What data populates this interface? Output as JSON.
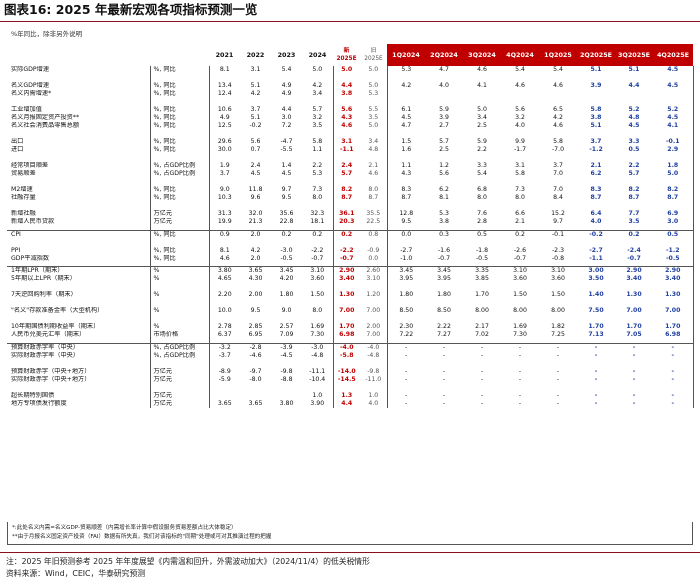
{
  "title": "图表16:  2025 年最新宏观各项指标预测一览",
  "unit_note": "%年同比，除非另外说明",
  "columns": {
    "years": [
      "2021",
      "2022",
      "2023",
      "2024"
    ],
    "est_line1": "新",
    "est_line2": "2025E",
    "prev_line1": "旧",
    "prev_line2": "2025E",
    "quarters": [
      "1Q2024",
      "2Q2024",
      "3Q2024",
      "4Q2024",
      "1Q2025",
      "2Q2025E",
      "3Q2025E",
      "4Q2025E"
    ]
  },
  "rows": [
    {
      "name": "实际GDP增速",
      "unit": "%, 同比",
      "y": [
        "8.1",
        "3.1",
        "5.4",
        "5.0"
      ],
      "e": "5.0",
      "p": "5.0",
      "q": [
        "5.3",
        "4.7",
        "4.6",
        "5.4",
        "5.4",
        "5.1",
        "5.1",
        "4.5"
      ]
    },
    {
      "gap": true
    },
    {
      "name": "名义GDP增速",
      "unit": "%, 同比",
      "y": [
        "13.4",
        "5.1",
        "4.9",
        "4.2"
      ],
      "e": "4.4",
      "p": "5.0",
      "q": [
        "4.2",
        "4.0",
        "4.1",
        "4.6",
        "4.6",
        "3.9",
        "4.4",
        "4.5"
      ]
    },
    {
      "name": "名义内需增速*",
      "unit": "%, 同比",
      "y": [
        "12.4",
        "4.2",
        "4.9",
        "3.4"
      ],
      "e": "3.8",
      "p": "5.3",
      "q": [
        "",
        "",
        "",
        "",
        "",
        "",
        "",
        ""
      ]
    },
    {
      "gap": true
    },
    {
      "name": "工业增加值",
      "unit": "%, 同比",
      "y": [
        "10.6",
        "3.7",
        "4.4",
        "5.7"
      ],
      "e": "5.6",
      "p": "5.5",
      "q": [
        "6.1",
        "5.9",
        "5.0",
        "5.6",
        "6.5",
        "5.8",
        "5.2",
        "5.2"
      ]
    },
    {
      "name": "名义月报固定资产投资**",
      "unit": "%, 同比",
      "y": [
        "4.9",
        "5.1",
        "3.0",
        "3.2"
      ],
      "e": "4.3",
      "p": "3.5",
      "q": [
        "4.5",
        "3.9",
        "3.4",
        "3.2",
        "4.2",
        "3.8",
        "4.8",
        "4.5"
      ]
    },
    {
      "name": "名义社会消费品零售总额",
      "unit": "%, 同比",
      "y": [
        "12.5",
        "-0.2",
        "7.2",
        "3.5"
      ],
      "e": "4.6",
      "p": "5.0",
      "q": [
        "4.7",
        "2.7",
        "2.5",
        "4.0",
        "4.6",
        "5.1",
        "4.5",
        "4.1"
      ]
    },
    {
      "gap": true
    },
    {
      "name": "出口",
      "unit": "%, 同比",
      "y": [
        "29.6",
        "5.6",
        "-4.7",
        "5.8"
      ],
      "e": "3.1",
      "p": "3.4",
      "q": [
        "1.5",
        "5.7",
        "5.9",
        "9.9",
        "5.8",
        "3.7",
        "3.3",
        "-0.1"
      ]
    },
    {
      "name": "进口",
      "unit": "%, 同比",
      "y": [
        "30.0",
        "0.7",
        "-5.5",
        "1.1"
      ],
      "e": "-1.1",
      "p": "4.8",
      "q": [
        "1.6",
        "2.5",
        "2.2",
        "-1.7",
        "-7.0",
        "-1.2",
        "0.5",
        "2.9"
      ]
    },
    {
      "gap": true
    },
    {
      "name": "经常项目顺差",
      "unit": "%, 占GDP比例",
      "y": [
        "1.9",
        "2.4",
        "1.4",
        "2.2"
      ],
      "e": "2.4",
      "p": "2.1",
      "q": [
        "1.1",
        "1.2",
        "3.3",
        "3.1",
        "3.7",
        "2.1",
        "2.2",
        "1.8"
      ]
    },
    {
      "name": "贸易顺差",
      "unit": "%, 占GDP比例",
      "y": [
        "3.7",
        "4.5",
        "4.5",
        "5.3"
      ],
      "e": "5.7",
      "p": "4.6",
      "q": [
        "4.3",
        "5.6",
        "5.4",
        "5.8",
        "7.0",
        "6.2",
        "5.7",
        "5.0"
      ]
    },
    {
      "gap": true
    },
    {
      "name": "M2增速",
      "unit": "%, 同比",
      "y": [
        "9.0",
        "11.8",
        "9.7",
        "7.3"
      ],
      "e": "8.2",
      "p": "8.0",
      "q": [
        "8.3",
        "6.2",
        "6.8",
        "7.3",
        "7.0",
        "8.3",
        "8.2",
        "8.2"
      ]
    },
    {
      "name": "社融存量",
      "unit": "%, 同比",
      "y": [
        "10.3",
        "9.6",
        "9.5",
        "8.0"
      ],
      "e": "8.7",
      "p": "8.7",
      "q": [
        "8.7",
        "8.1",
        "8.0",
        "8.0",
        "8.4",
        "8.7",
        "8.7",
        "8.7"
      ]
    },
    {
      "gap": true
    },
    {
      "name": "新增社融",
      "unit": "万亿元",
      "y": [
        "31.3",
        "32.0",
        "35.6",
        "32.3"
      ],
      "e": "36.1",
      "p": "35.5",
      "q": [
        "12.8",
        "5.3",
        "7.6",
        "6.6",
        "15.2",
        "6.4",
        "7.7",
        "6.9"
      ]
    },
    {
      "name": "新增人民币贷款",
      "unit": "万亿元",
      "y": [
        "19.9",
        "21.3",
        "22.8",
        "18.1"
      ],
      "e": "20.3",
      "p": "22.5",
      "q": [
        "9.5",
        "3.8",
        "2.8",
        "2.1",
        "9.7",
        "4.0",
        "3.5",
        "3.0"
      ]
    },
    {
      "sep": true
    },
    {
      "name": "CPI",
      "unit": "%, 同比",
      "y": [
        "0.9",
        "2.0",
        "0.2",
        "0.2"
      ],
      "e": "0.2",
      "p": "0.8",
      "q": [
        "0.0",
        "0.3",
        "0.5",
        "0.2",
        "-0.1",
        "-0.2",
        "0.2",
        "0.5"
      ]
    },
    {
      "gap": true
    },
    {
      "name": "PPI",
      "unit": "%, 同比",
      "y": [
        "8.1",
        "4.2",
        "-3.0",
        "-2.2"
      ],
      "e": "-2.2",
      "p": "-0.9",
      "q": [
        "-2.7",
        "-1.6",
        "-1.8",
        "-2.6",
        "-2.3",
        "-2.7",
        "-2.4",
        "-1.2"
      ]
    },
    {
      "name": "GDP平减指数",
      "unit": "%, 同比",
      "y": [
        "4.6",
        "2.0",
        "-0.5",
        "-0.7"
      ],
      "e": "-0.7",
      "p": "0.0",
      "q": [
        "-1.0",
        "-0.7",
        "-0.5",
        "-0.7",
        "-0.8",
        "-1.1",
        "-0.7",
        "-0.5"
      ]
    },
    {
      "sep": true
    },
    {
      "name": "1年期LPR（期末）",
      "unit": "%",
      "y": [
        "3.80",
        "3.65",
        "3.45",
        "3.10"
      ],
      "e": "2.90",
      "p": "2.60",
      "q": [
        "3.45",
        "3.45",
        "3.35",
        "3.10",
        "3.10",
        "3.00",
        "2.90",
        "2.90"
      ]
    },
    {
      "name": "5年期以上LPR（期末）",
      "unit": "%",
      "y": [
        "4.65",
        "4.30",
        "4.20",
        "3.60"
      ],
      "e": "3.40",
      "p": "3.10",
      "q": [
        "3.95",
        "3.95",
        "3.85",
        "3.60",
        "3.60",
        "3.50",
        "3.40",
        "3.40"
      ]
    },
    {
      "gap": true
    },
    {
      "name": "7天逆回购利率（期末）",
      "unit": "%",
      "y": [
        "2.20",
        "2.00",
        "1.80",
        "1.50"
      ],
      "e": "1.30",
      "p": "1.20",
      "q": [
        "1.80",
        "1.80",
        "1.70",
        "1.50",
        "1.50",
        "1.40",
        "1.30",
        "1.30"
      ]
    },
    {
      "gap": true
    },
    {
      "name": "\"名义\"存款准备金率（大型机构）",
      "unit": "%",
      "y": [
        "10.0",
        "9.5",
        "9.0",
        "8.0"
      ],
      "e": "7.00",
      "p": "7.00",
      "q": [
        "8.50",
        "8.50",
        "8.00",
        "8.00",
        "8.00",
        "7.50",
        "7.00",
        "7.00"
      ]
    },
    {
      "gap": true
    },
    {
      "name": "10年期国债利期收益率（期末）",
      "unit": "%",
      "y": [
        "2.78",
        "2.85",
        "2.57",
        "1.69"
      ],
      "e": "1.70",
      "p": "2.00",
      "q": [
        "2.30",
        "2.22",
        "2.17",
        "1.69",
        "1.82",
        "1.70",
        "1.70",
        "1.70"
      ]
    },
    {
      "name": "人民币兑美元汇率（期末）",
      "unit": "市场价格",
      "y": [
        "6.37",
        "6.95",
        "7.09",
        "7.30"
      ],
      "e": "6.98",
      "p": "7.00",
      "q": [
        "7.22",
        "7.27",
        "7.02",
        "7.30",
        "7.25",
        "7.13",
        "7.05",
        "6.98"
      ]
    },
    {
      "sep": true
    },
    {
      "name": "预算财政赤字率（中央）",
      "unit": "%, 占GDP比例",
      "y": [
        "-3.2",
        "-2.8",
        "-3.9",
        "-3.0"
      ],
      "e": "-4.0",
      "p": "-4.0",
      "q": [
        "-",
        "-",
        "-",
        "-",
        "-",
        "-",
        "-",
        "-"
      ]
    },
    {
      "name": "实际财政赤字率（中央）",
      "unit": "%, 占GDP比例",
      "y": [
        "-3.7",
        "-4.6",
        "-4.5",
        "-4.8"
      ],
      "e": "-5.8",
      "p": "-4.8",
      "q": [
        "-",
        "-",
        "-",
        "-",
        "-",
        "-",
        "-",
        "-"
      ]
    },
    {
      "gap": true
    },
    {
      "name": "预算财政赤字（中央+地方）",
      "unit": "万亿元",
      "y": [
        "-8.9",
        "-9.7",
        "-9.8",
        "-11.1"
      ],
      "e": "-14.0",
      "p": "-9.8",
      "q": [
        "-",
        "-",
        "-",
        "-",
        "-",
        "-",
        "-",
        "-"
      ]
    },
    {
      "name": "实际财政赤字（中央+地方）",
      "unit": "万亿元",
      "y": [
        "-5.9",
        "-8.0",
        "-8.8",
        "-10.4"
      ],
      "e": "-14.5",
      "p": "-11.0",
      "q": [
        "-",
        "-",
        "-",
        "-",
        "-",
        "-",
        "-",
        "-"
      ]
    },
    {
      "gap": true
    },
    {
      "name": "超长期特别国债",
      "unit": "万亿元",
      "y": [
        "",
        "",
        "",
        "1.0"
      ],
      "e": "1.3",
      "p": "1.0",
      "q": [
        "-",
        "-",
        "-",
        "-",
        "-",
        "-",
        "-",
        "-"
      ]
    },
    {
      "name": "地方专项债发行额度",
      "unit": "万亿元",
      "y": [
        "3.65",
        "3.65",
        "3.80",
        "3.90"
      ],
      "e": "4.4",
      "p": "4.0",
      "q": [
        "-",
        "-",
        "-",
        "-",
        "-",
        "-",
        "-",
        "-"
      ]
    }
  ],
  "highlighted_quarters": [
    5,
    6,
    7
  ],
  "notes": [
    "*:此处名义内需=名义GDP-贸易顺差（内需增长率计算中假设服务贸易差额占比大体稳定）",
    "**由于月报名义固定资产投资（FAI）数据有所失真，我们对该指标的\"同期\"处理或可对其推演过程的把握"
  ],
  "footer": [
    "注：2025 年旧预测参考 2025 年年度展望《内需温和回升，外需波动加大》（2024/11/4）的低关税情形",
    "资料来源：Wind，CEIC，华泰研究预测"
  ]
}
